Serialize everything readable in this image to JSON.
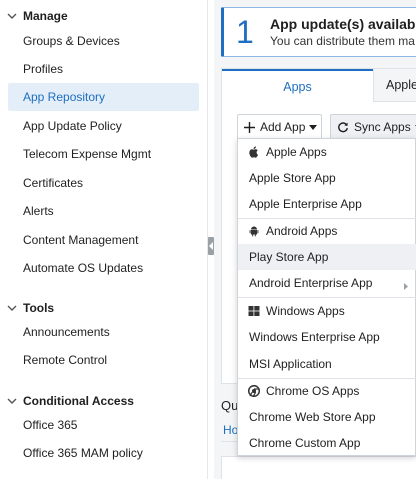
{
  "sidebar": {
    "sections": [
      {
        "title": "Manage",
        "items": [
          "Groups & Devices",
          "Profiles",
          "App Repository",
          "App Update Policy",
          "Telecom Expense Mgmt",
          "Certificates",
          "Alerts",
          "Content Management",
          "Automate OS Updates"
        ]
      },
      {
        "title": "Tools",
        "items": [
          "Announcements",
          "Remote Control"
        ]
      },
      {
        "title": "Conditional Access",
        "items": [
          "Office 365",
          "Office 365 MAM policy"
        ]
      }
    ],
    "active_item": "App Repository"
  },
  "banner": {
    "count": "1",
    "title": "App update(s) available",
    "subtitle": "You can distribute them ma"
  },
  "tabs": {
    "apps": "Apps",
    "apple": "Apple"
  },
  "toolbar": {
    "add_app": "Add App",
    "sync_apps": "Sync Apps"
  },
  "quick_label": "Qu",
  "ho_label": "Ho",
  "dropdown": {
    "apple_header": "Apple Apps",
    "apple_store": "Apple Store App",
    "apple_enterprise": "Apple Enterprise App",
    "android_header": "Android Apps",
    "play_store": "Play Store App",
    "android_enterprise": "Android Enterprise App",
    "windows_header": "Windows Apps",
    "windows_enterprise": "Windows Enterprise App",
    "msi": "MSI Application",
    "chrome_header": "Chrome OS Apps",
    "chrome_web_store": "Chrome Web Store App",
    "chrome_custom": "Chrome Custom App"
  },
  "colors": {
    "accent": "#1e6fc1",
    "active_bg": "#e4eef8",
    "hover_bg": "#eef0f3"
  }
}
